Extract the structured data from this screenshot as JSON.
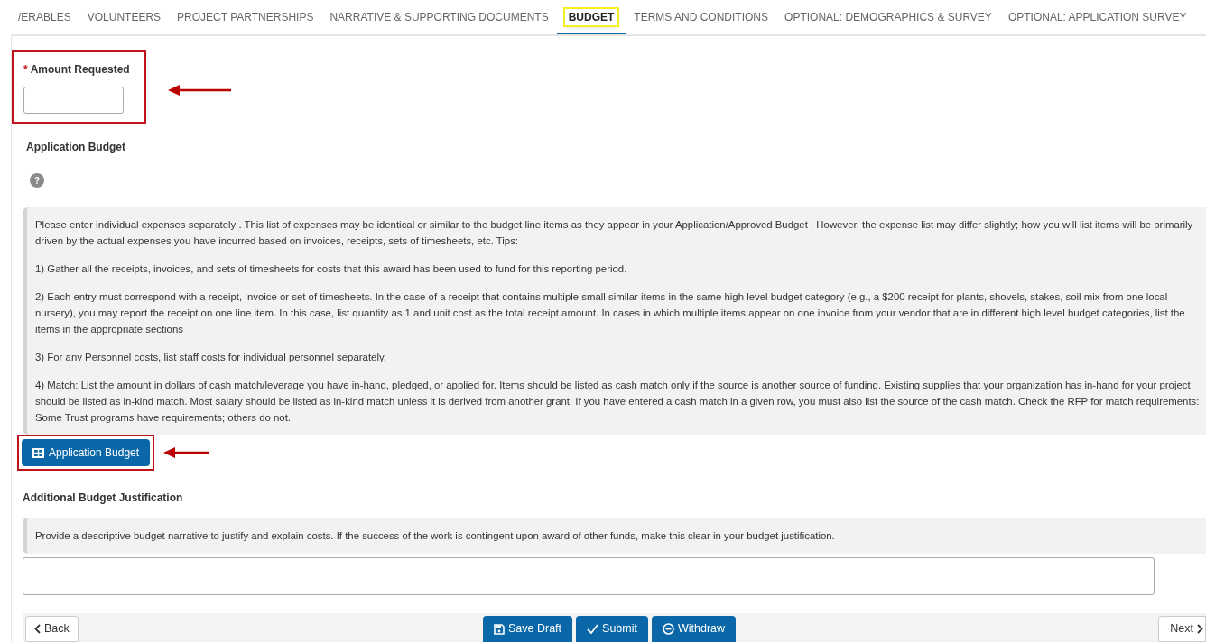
{
  "tabs": [
    {
      "label": "/ERABLES",
      "selected": false
    },
    {
      "label": "VOLUNTEERS",
      "selected": false
    },
    {
      "label": "PROJECT PARTNERSHIPS",
      "selected": false
    },
    {
      "label": "NARRATIVE & SUPPORTING DOCUMENTS",
      "selected": false
    },
    {
      "label": "BUDGET",
      "selected": true
    },
    {
      "label": "TERMS AND CONDITIONS",
      "selected": false
    },
    {
      "label": "OPTIONAL: DEMOGRAPHICS & SURVEY",
      "selected": false
    },
    {
      "label": "OPTIONAL: APPLICATION SURVEY",
      "selected": false
    }
  ],
  "amount_requested": {
    "required_mark": "*",
    "label": "Amount Requested"
  },
  "application_budget": {
    "label": "Application Budget",
    "help": "?",
    "instructions": [
      "Please enter individual expenses separately . This list of expenses may be identical or similar to the budget line items as they appear in your Application/Approved Budget . However, the expense list may differ slightly; how you will list items will be primarily driven by the actual expenses you have incurred based on invoices, receipts, sets of timesheets, etc. Tips:",
      "1) Gather all the receipts, invoices, and sets of timesheets for costs that this award has been used to fund for this reporting period.",
      "2) Each entry must correspond with a receipt, invoice or set of timesheets. In the case of a receipt that contains multiple small similar items in the same high level budget category (e.g., a $200 receipt for plants, shovels, stakes, soil mix from one local nursery), you may report the receipt on one line item. In this case, list quantity as 1 and unit cost as the total receipt amount. In cases in which multiple items appear on one invoice from your vendor that are in different high level budget categories, list the items in the appropriate sections",
      "3) For any Personnel costs, list staff costs for individual personnel separately.",
      "4) Match: List the amount in dollars of cash match/leverage you have in-hand, pledged, or applied for. Items should be listed as cash match only if the source is another source of funding. Existing supplies that your organization has in-hand for your project should be listed as in-kind match. Most salary should be listed as in-kind match unless it is derived from another grant. If you have entered a cash match in a given row, you must also list the source of the cash match. Check the RFP for match requirements: Some Trust programs have requirements; others do not."
    ],
    "button": "Application Budget"
  },
  "justification": {
    "label": "Additional Budget Justification",
    "instructions": "Provide a descriptive budget narrative to justify and explain costs. If the success of the work is contingent upon award of other funds, make this clear in your budget justification."
  },
  "footer": {
    "back": "Back",
    "actions": [
      {
        "kind": "save",
        "label": "Save Draft"
      },
      {
        "kind": "submit",
        "label": "Submit"
      },
      {
        "kind": "withdraw",
        "label": "Withdraw"
      }
    ],
    "next": "Next"
  }
}
